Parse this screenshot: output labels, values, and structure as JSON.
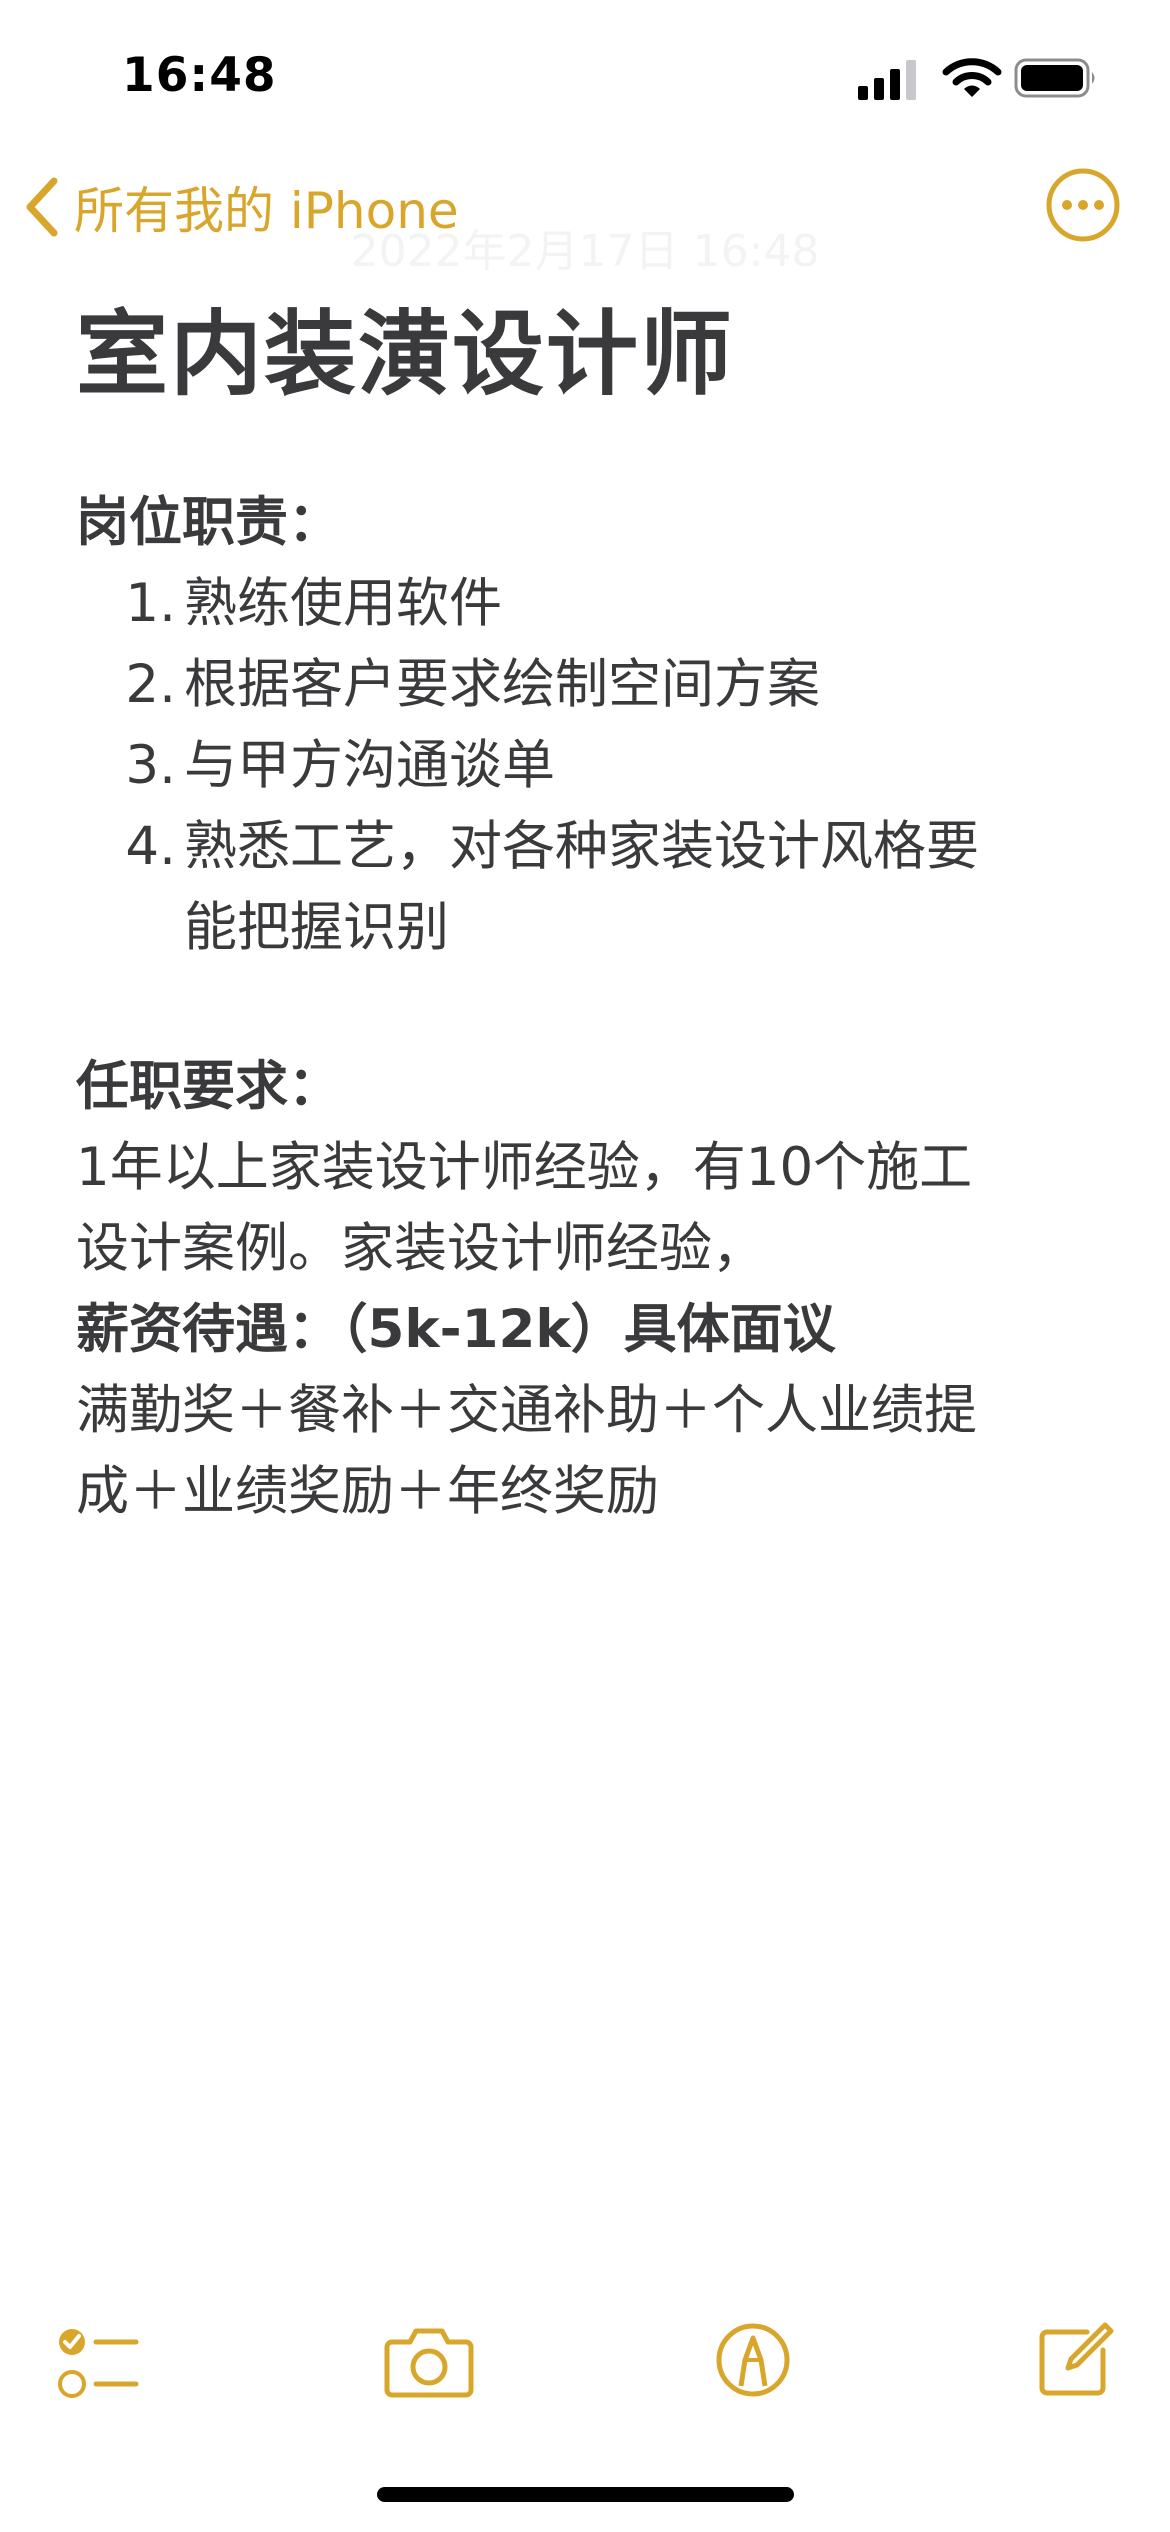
{
  "status_bar": {
    "time": "16:48"
  },
  "nav": {
    "back_label": "所有我的 iPhone",
    "date": "2022年2月17日 16:48"
  },
  "note": {
    "title": "室内装潢设计师",
    "section1_heading": "岗位职责：",
    "duties": [
      {
        "num": "1.",
        "text": "熟练使用软件"
      },
      {
        "num": "2.",
        "text": "根据客户要求绘制空间方案"
      },
      {
        "num": "3.",
        "text": "与甲方沟通谈单"
      },
      {
        "num": "4.",
        "text": "熟悉工艺，对各种家装设计风格要",
        "cont": "能把握识别"
      }
    ],
    "section2_heading": "任职要求：",
    "requirements_line1": "1年以上家装设计师经验，有10个施工",
    "requirements_line2": "设计案例。家装设计师经验，",
    "salary_line": "薪资待遇：（5k-12k）具体面议",
    "benefits_line1": "满勤奖＋餐补＋交通补助＋个人业绩提",
    "benefits_line2": "成＋业绩奖励＋年终奖励"
  },
  "colors": {
    "accent": "#d9a62c",
    "text": "#3a3a3c"
  },
  "icons": {
    "back": "chevron-left-icon",
    "more": "ellipsis-circle-icon",
    "checklist": "checklist-icon",
    "camera": "camera-icon",
    "markup": "pen-tip-circle-icon",
    "compose": "compose-icon"
  }
}
